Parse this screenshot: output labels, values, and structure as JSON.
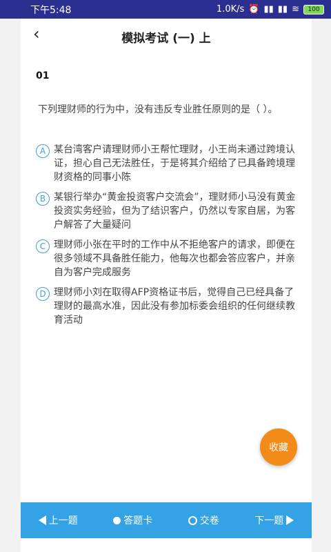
{
  "status_bar": {
    "time": "下午5:48",
    "speed": "1.0K/s",
    "battery": "100"
  },
  "header": {
    "title": "模拟考试 (一) 上"
  },
  "question": {
    "number": "01",
    "stem": "下列理财师的行为中，没有违反专业胜任原则的是（ ）。",
    "options": [
      {
        "letter": "A",
        "text": "某台湾客户请理财师小王帮忙理财，小王尚未通过跨境认证，担心自己无法胜任，于是将其介绍给了已具备跨境理财资格的同事小陈"
      },
      {
        "letter": "B",
        "text": "某银行举办“黄金投资客户交流会”，理财师小马没有黄金投资实务经验，但为了结识客户，仍然以专家自居，为客户解答了大量疑问"
      },
      {
        "letter": "C",
        "text": "理财师小张在平时的工作中从不拒绝客户的请求，即便在很多领域不具备胜任能力，他每次也都会答应客户，并亲自为客户完成服务"
      },
      {
        "letter": "D",
        "text": "理财师小刘在取得AFP资格证书后，觉得自己已经具备了理财的最高水准，因此没有参加标委会组织的任何继续教育活动"
      }
    ]
  },
  "collect_button": "收藏",
  "bottom_nav": {
    "prev": "上一题",
    "answer_card": "答题卡",
    "submit": "交卷",
    "next": "下一题"
  },
  "colors": {
    "status_bar": "#2b2f8f",
    "accent_blue": "#33a3e6",
    "option_circle": "#3f9fe0",
    "collect_orange": "#f28b17"
  }
}
